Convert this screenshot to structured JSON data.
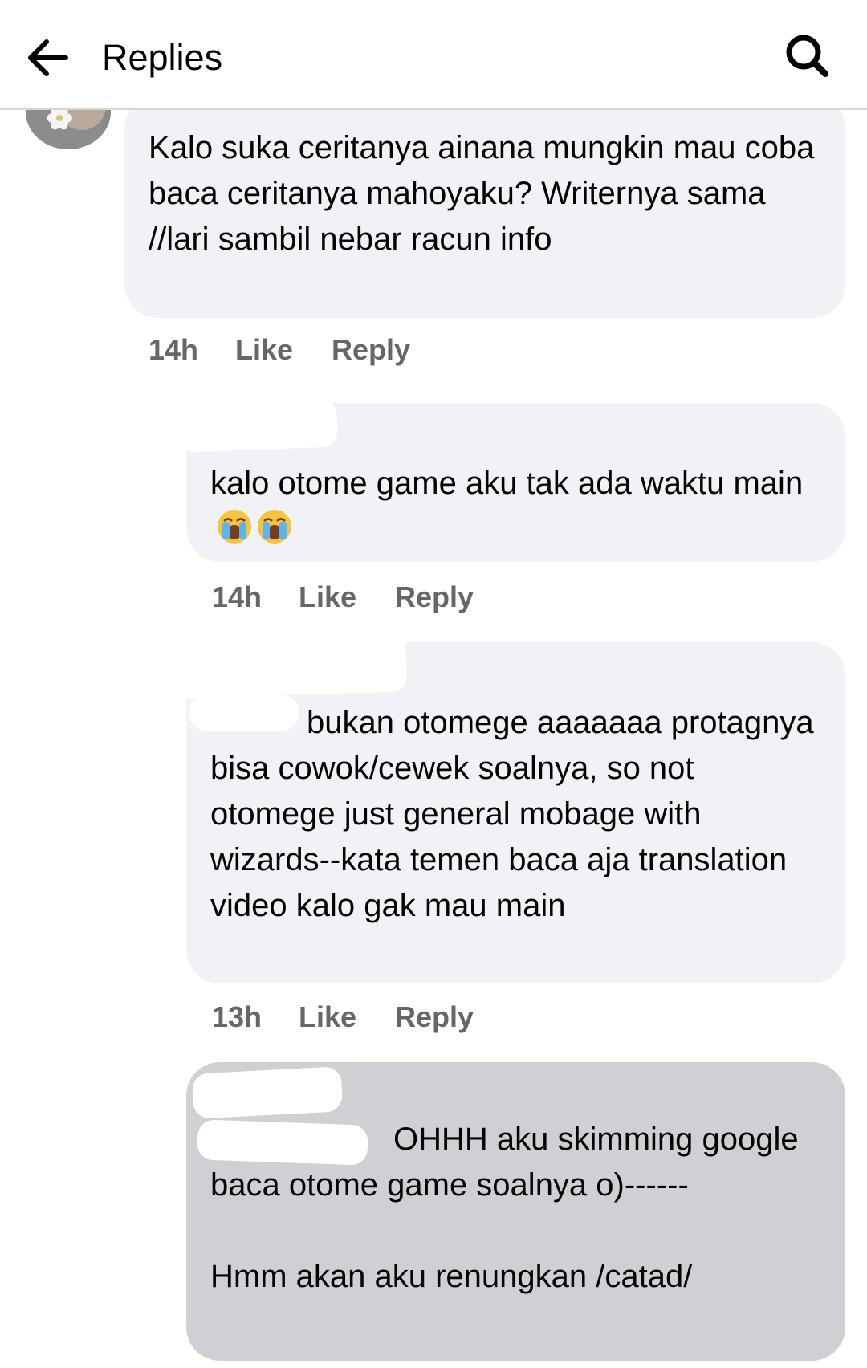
{
  "header": {
    "title": "Replies"
  },
  "comments": [
    {
      "text": "Kalo suka ceritanya ainana mungkin mau coba baca ceritanya mahoyaku? Writernya sama //lari sambil nebar racun info",
      "time": "14h",
      "like_label": "Like",
      "reply_label": "Reply"
    },
    {
      "text": "kalo otome game aku tak ada waktu main",
      "emoji": "loudly-crying-face",
      "time": "14h",
      "like_label": "Like",
      "reply_label": "Reply"
    },
    {
      "text": "bukan otomege aaaaaaa protagnya bisa cowok/cewek soalnya, so not otomege just general mobage with wizards--kata temen baca aja translation video kalo gak mau main",
      "time": "13h",
      "like_label": "Like",
      "reply_label": "Reply"
    },
    {
      "text": "OHHH aku skimming google baca otome game soalnya o)------\n\nHmm akan aku renungkan /catad/"
    }
  ],
  "colors": {
    "bubble": "#f0f2f5",
    "bubble_selected": "#ced0d4",
    "meta_text": "#65676b",
    "mention": "#1877f2"
  }
}
